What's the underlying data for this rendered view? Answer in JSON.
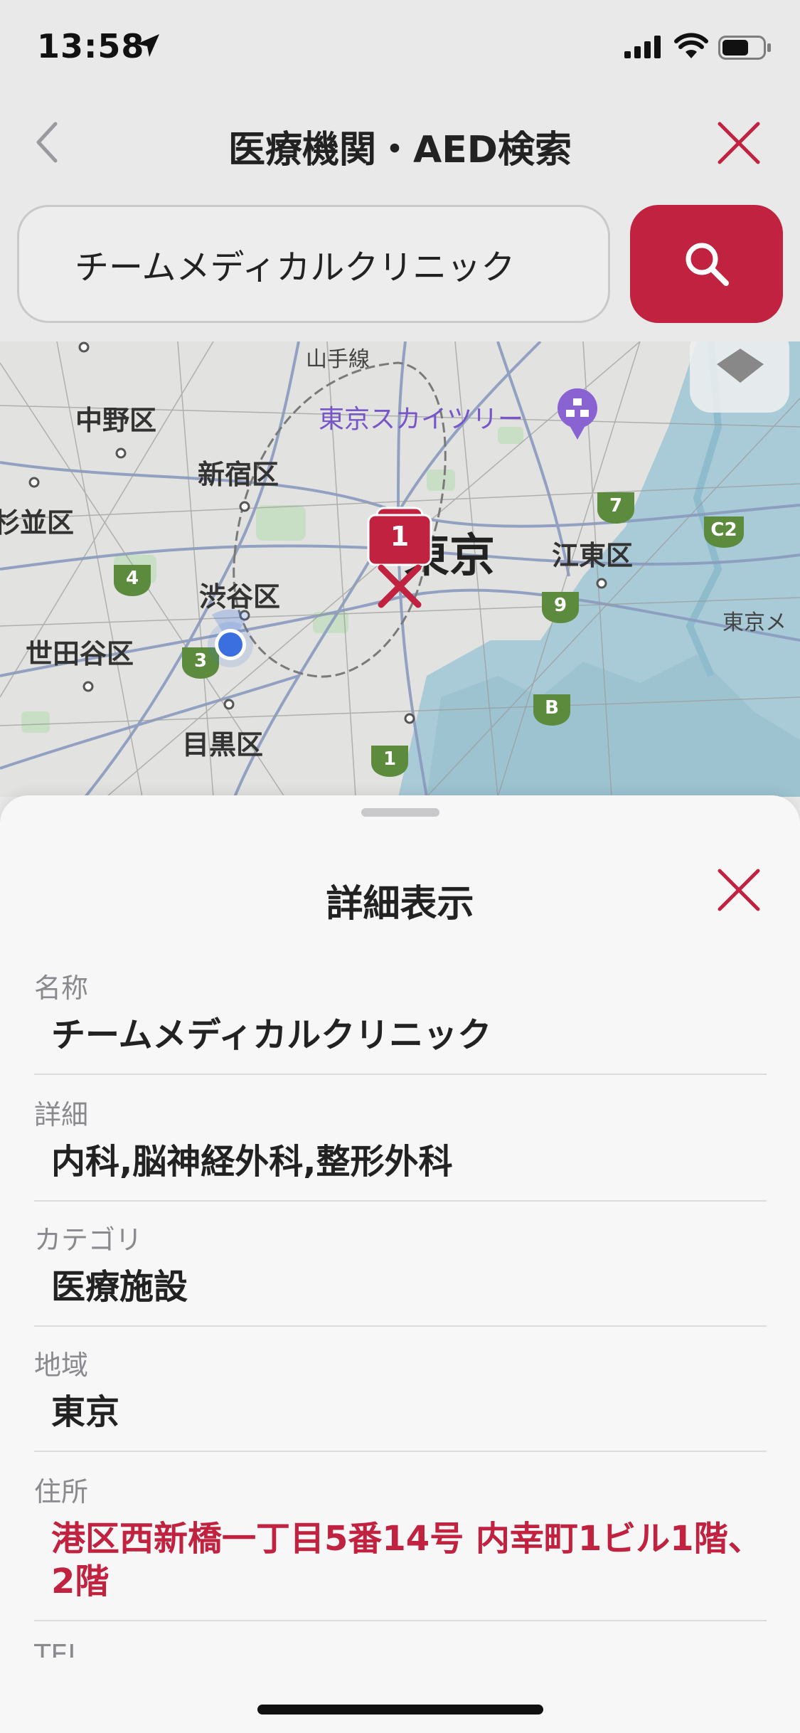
{
  "status_bar": {
    "time": "13:58"
  },
  "header": {
    "title": "医療機関・AED検索"
  },
  "search": {
    "value": "チームメディカルクリニック"
  },
  "map": {
    "labels": {
      "nakano": "中野区",
      "shinjuku": "新宿区",
      "suginami": "杉並区",
      "shibuya": "渋谷区",
      "setagaya": "世田谷区",
      "meguro": "目黒区",
      "tokyo": "東京",
      "koto": "江東区",
      "skytree": "東京スカイツリー",
      "yamanote": "山手線",
      "tokyo_bay": "東京メ"
    },
    "route_shields": {
      "s4": "4",
      "s3": "3",
      "s7": "7",
      "s9": "9",
      "sC2": "C2",
      "sB": "B",
      "s1": "1"
    },
    "cluster_count": "1"
  },
  "detail": {
    "title": "詳細表示",
    "rows": [
      {
        "label": "名称",
        "value": "チームメディカルクリニック"
      },
      {
        "label": "詳細",
        "value": "内科,脳神経外科,整形外科"
      },
      {
        "label": "カテゴリ",
        "value": "医療施設"
      },
      {
        "label": "地域",
        "value": "東京"
      },
      {
        "label": "住所",
        "value": "港区西新橋一丁目5番14号 内幸町1ビル1階、2階"
      },
      {
        "label": "TEL"
      }
    ]
  },
  "colors": {
    "accent": "#c0223f",
    "poi": "#7656c8",
    "user_location": "#3b6fe0"
  }
}
